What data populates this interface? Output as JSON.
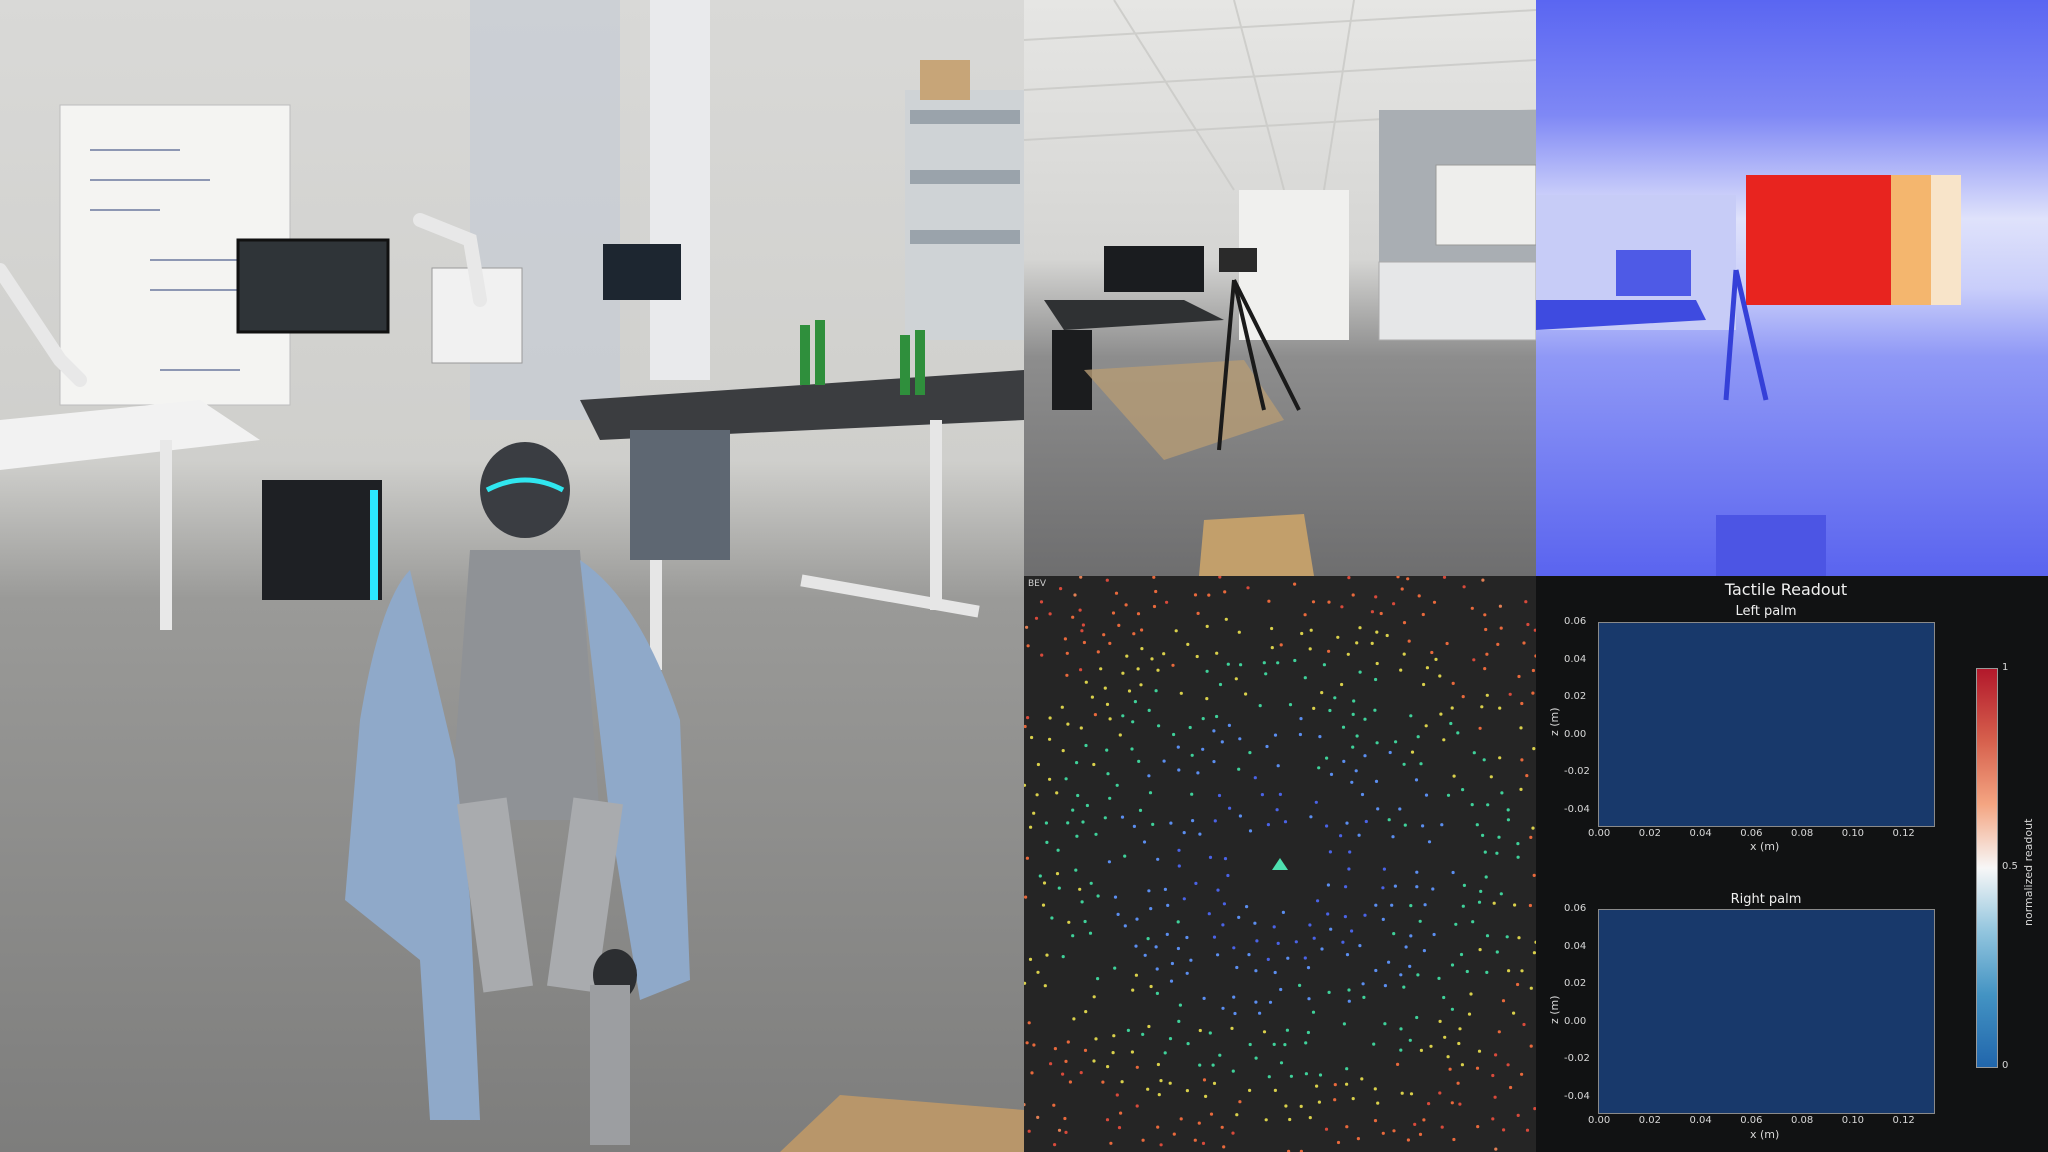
{
  "panels": {
    "main_camera": {
      "icon": "robot-camera-view"
    },
    "front_camera": {
      "icon": "front-camera-view"
    },
    "depth": {
      "icon": "depth-map-view"
    },
    "bev": {
      "label": "BEV"
    },
    "tactile": {
      "title": "Tactile Readout",
      "palms": [
        {
          "title": "Left palm",
          "ylabel": "z (m)",
          "xlabel": "x (m)"
        },
        {
          "title": "Right palm",
          "ylabel": "z (m)",
          "xlabel": "x (m)"
        }
      ],
      "x_ticks": [
        "0.00",
        "0.02",
        "0.04",
        "0.06",
        "0.08",
        "0.10",
        "0.12"
      ],
      "y_ticks": [
        "0.06",
        "0.04",
        "0.02",
        "0.00",
        "-0.02",
        "-0.04"
      ],
      "colorbar": {
        "label": "normalized readout",
        "ticks": [
          "1",
          "0.5",
          "0"
        ]
      }
    }
  },
  "colors": {
    "heat_fill": "#18396b",
    "bev_bg": "#252525",
    "depth_near": "#e8241f"
  }
}
